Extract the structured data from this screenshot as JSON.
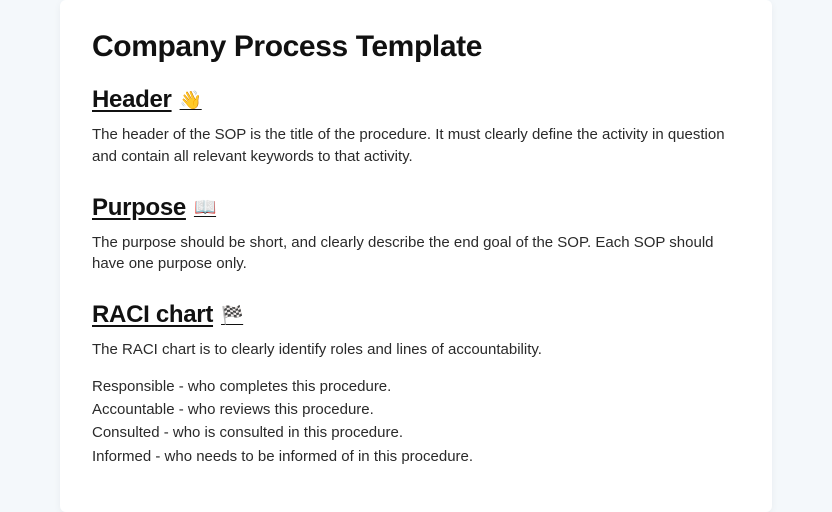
{
  "title": "Company Process Template",
  "sections": {
    "header": {
      "heading": "Header",
      "emoji": "👋",
      "body": "The header of the SOP is the title of the procedure. It must clearly define the activity in question and contain all relevant keywords to that activity."
    },
    "purpose": {
      "heading": "Purpose",
      "emoji": "📖",
      "body": "The purpose should be short, and clearly describe the end goal of the SOP. Each SOP should have one purpose only."
    },
    "raci": {
      "heading": "RACI chart",
      "emoji": "🏁",
      "intro": "The RACI chart is to clearly identify roles and lines of accountability.",
      "roles": [
        "Responsible - who completes this procedure.",
        "Accountable - who reviews this procedure.",
        "Consulted - who is consulted in this procedure.",
        "Informed - who needs to be informed of in this procedure."
      ]
    }
  }
}
